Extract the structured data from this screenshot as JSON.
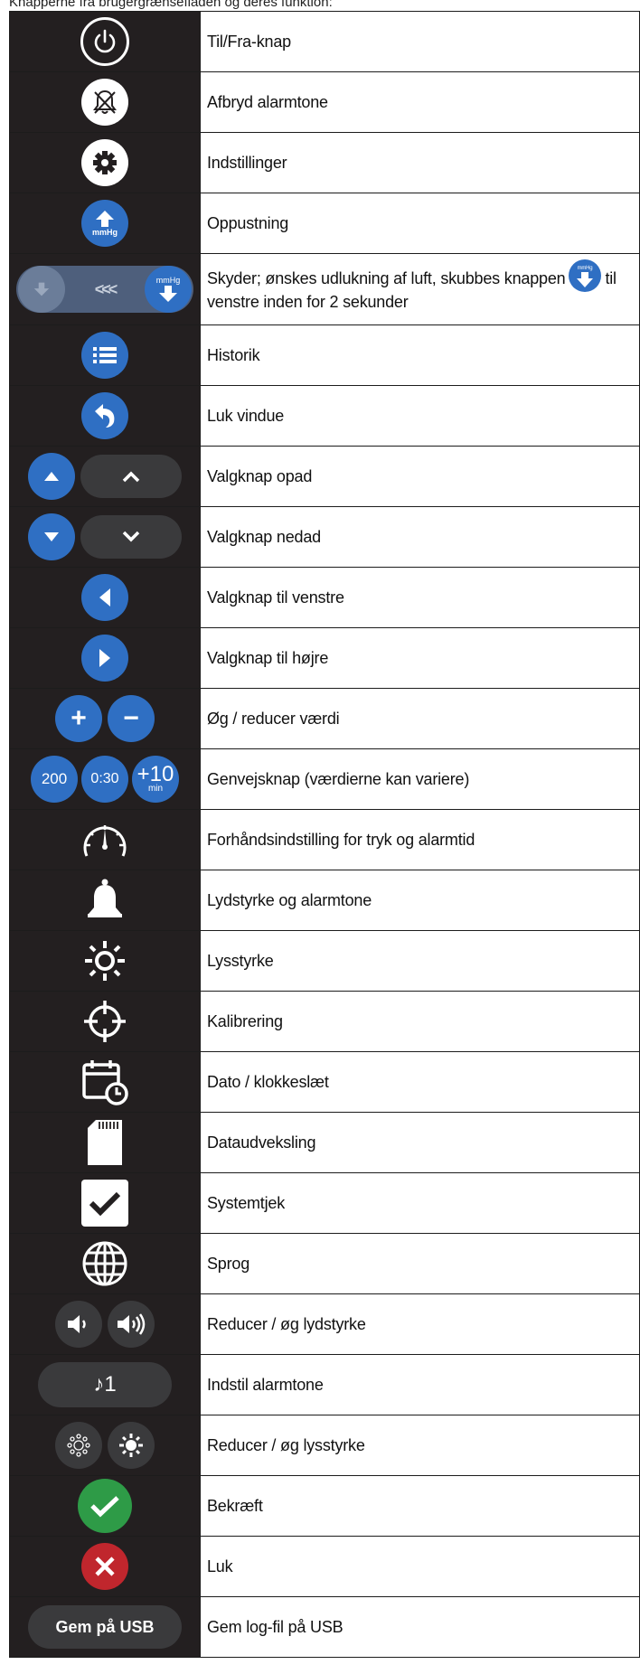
{
  "top_note": "Knapperne fra brugergrænsefladen og deres funktion:",
  "rows": [
    {
      "desc": "Til/Fra-knap",
      "icon": "power-icon"
    },
    {
      "desc": "Afbryd alarmtone",
      "icon": "alarm-mute-icon"
    },
    {
      "desc": "Indstillinger",
      "icon": "gear-icon"
    },
    {
      "desc": "Oppustning",
      "icon": "inflate-mmhg-icon",
      "label": "mmHg"
    },
    {
      "desc_part1": "Skyder; ønskes udlukning af luft, skubbes knappen",
      "desc_part2": "til venstre inden for 2 sekunder",
      "icon": "deflate-slider-icon",
      "label": "mmHg",
      "arrows": "<<<"
    },
    {
      "desc": "Historik",
      "icon": "list-icon"
    },
    {
      "desc": "Luk vindue",
      "icon": "back-arrow-icon"
    },
    {
      "desc": "Valgknap opad",
      "icon": "chevron-up-icon"
    },
    {
      "desc": "Valgknap nedad",
      "icon": "chevron-down-icon"
    },
    {
      "desc": "Valgknap til venstre",
      "icon": "triangle-left-icon"
    },
    {
      "desc": "Valgknap til højre",
      "icon": "triangle-right-icon"
    },
    {
      "desc": "Øg / reducer værdi",
      "icon": "plus-minus-icon",
      "plus": "+",
      "minus": "−"
    },
    {
      "desc": "Genvejsknap (værdierne kan variere)",
      "icon": "shortcut-icons",
      "values": [
        "200",
        "0:30",
        "+10",
        "min"
      ]
    },
    {
      "desc": "Forhåndsindstilling for tryk og alarmtid",
      "icon": "gauge-icon"
    },
    {
      "desc": "Lydstyrke og alarmtone",
      "icon": "bell-icon"
    },
    {
      "desc": "Lysstyrke",
      "icon": "sun-icon"
    },
    {
      "desc": "Kalibrering",
      "icon": "crosshair-icon"
    },
    {
      "desc": "Dato / klokkeslæt",
      "icon": "calendar-clock-icon"
    },
    {
      "desc": "Dataudveksling",
      "icon": "sd-card-icon"
    },
    {
      "desc": "Systemtjek",
      "icon": "checkbox-icon"
    },
    {
      "desc": "Sprog",
      "icon": "globe-icon"
    },
    {
      "desc": "Reducer / øg lydstyrke",
      "icon": "volume-icons"
    },
    {
      "desc": "Indstil alarmtone",
      "icon": "tone-select-icon",
      "label": "♪1"
    },
    {
      "desc": "Reducer / øg lysstyrke",
      "icon": "brightness-icons"
    },
    {
      "desc": "Bekræft",
      "icon": "confirm-check-icon"
    },
    {
      "desc": "Luk",
      "icon": "close-x-icon"
    },
    {
      "desc": "Gem log-fil på USB",
      "icon": "save-usb-button",
      "label": "Gem på USB"
    }
  ],
  "colors": {
    "dark": "#231f20",
    "blue": "#2f6fc3",
    "green": "#2e9b47",
    "red": "#c0262d"
  }
}
